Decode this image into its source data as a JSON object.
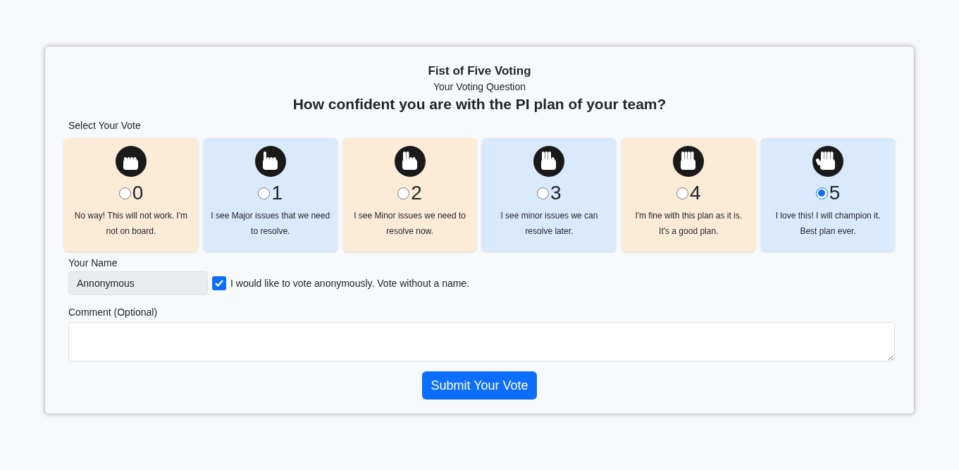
{
  "title": "Fist of Five Voting",
  "subtitle": "Your Voting Question",
  "question": "How confident you are with the PI plan of your team?",
  "vote_label": "Select Your Vote",
  "options": [
    {
      "value": "0",
      "description": "No way! This will not work. I'm not on board.",
      "color": "#fcebd7",
      "selected": false
    },
    {
      "value": "1",
      "description": "I see Major issues that we need to resolve.",
      "color": "#d9eafd",
      "selected": false
    },
    {
      "value": "2",
      "description": "I see Minor issues we need to resolve now.",
      "color": "#fcebd7",
      "selected": false
    },
    {
      "value": "3",
      "description": "I see minor issues we can resolve later.",
      "color": "#d9eafd",
      "selected": false
    },
    {
      "value": "4",
      "description": "I'm fine with this plan as it is. It's a good plan.",
      "color": "#fcebd7",
      "selected": false
    },
    {
      "value": "5",
      "description": "I love this! I will champion it. Best plan ever.",
      "color": "#d9eafd",
      "selected": true
    }
  ],
  "name": {
    "label": "Your Name",
    "value": "Annonymous",
    "disabled": true
  },
  "anonymous": {
    "label": "I would like to vote anonymously. Vote without a name.",
    "checked": true
  },
  "comment": {
    "label": "Comment (Optional)"
  },
  "submit": "Submit Your Vote"
}
